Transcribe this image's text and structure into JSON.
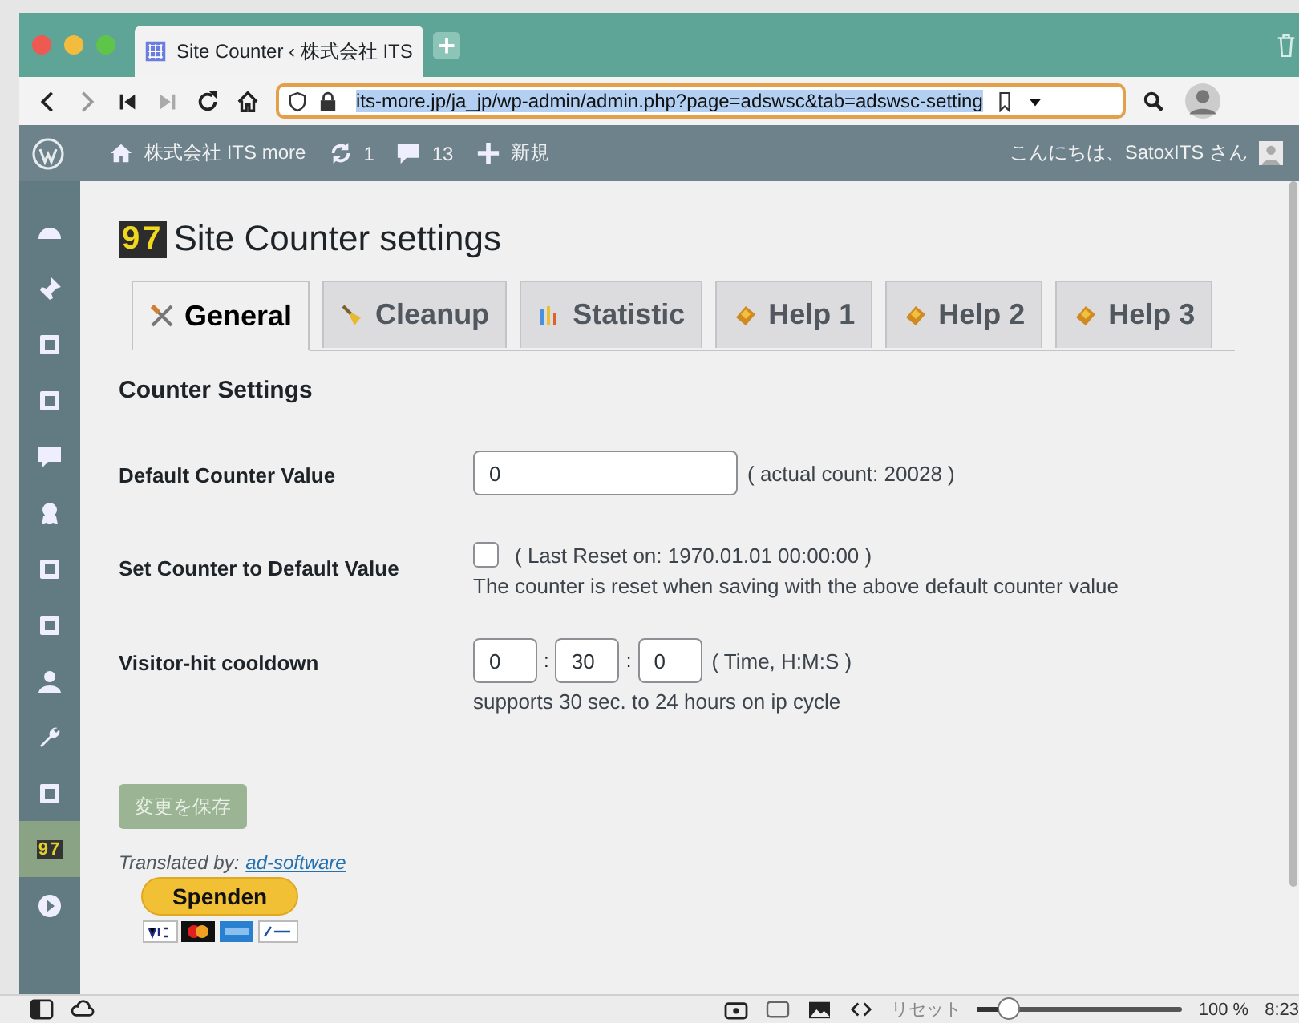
{
  "browser": {
    "tab_title": "Site Counter ‹ 株式会社 ITS",
    "url": "its-more.jp/ja_jp/wp-admin/admin.php?page=adswsc&tab=adswsc-setting"
  },
  "admin_bar": {
    "site": "株式会社 ITS more",
    "updates": "1",
    "comments": "13",
    "new": "新規",
    "greeting": "こんにちは、SatoxITS さん"
  },
  "sidebar": {
    "items": [
      {
        "selected": false
      },
      {
        "selected": false
      },
      {
        "selected": false
      },
      {
        "selected": false
      },
      {
        "selected": false
      },
      {
        "selected": false
      },
      {
        "selected": false
      },
      {
        "selected": false
      },
      {
        "selected": false
      },
      {
        "selected": false
      },
      {
        "selected": false
      },
      {
        "selected": true,
        "logo": "97"
      },
      {
        "selected": false
      }
    ]
  },
  "page": {
    "logo": "97",
    "title": "Site Counter settings",
    "tabs": [
      {
        "label": "General",
        "selected": true
      },
      {
        "label": "Cleanup",
        "selected": false
      },
      {
        "label": "Statistic",
        "selected": false
      },
      {
        "label": "Help 1",
        "selected": false
      },
      {
        "label": "Help 2",
        "selected": false
      },
      {
        "label": "Help 3",
        "selected": false
      }
    ],
    "section": "Counter Settings",
    "default_value": {
      "label": "Default Counter Value",
      "value": "0",
      "note": "( actual count: 20028 )"
    },
    "reset": {
      "label": "Set Counter to Default Value",
      "checked": false,
      "note": "( Last Reset on: 1970.01.01 00:00:00 )",
      "help": "The counter is reset when saving with the above default counter value"
    },
    "cooldown": {
      "label": "Visitor-hit cooldown",
      "separator": ":",
      "hours": "0",
      "minutes": "30",
      "seconds": "0",
      "note": "( Time, H:M:S )",
      "help": "supports 30 sec. to 24 hours on ip cycle"
    },
    "save_button": {
      "label": "変更を保存",
      "disabled": true
    },
    "translated_by": {
      "label": "Translated by:",
      "link": "ad-software"
    },
    "donate": {
      "label": "Spenden"
    }
  },
  "status_bar": {
    "reset": "リセット",
    "zoom": {
      "level": 0.15
    },
    "zoom_text": "100 %",
    "time": "8:23"
  }
}
